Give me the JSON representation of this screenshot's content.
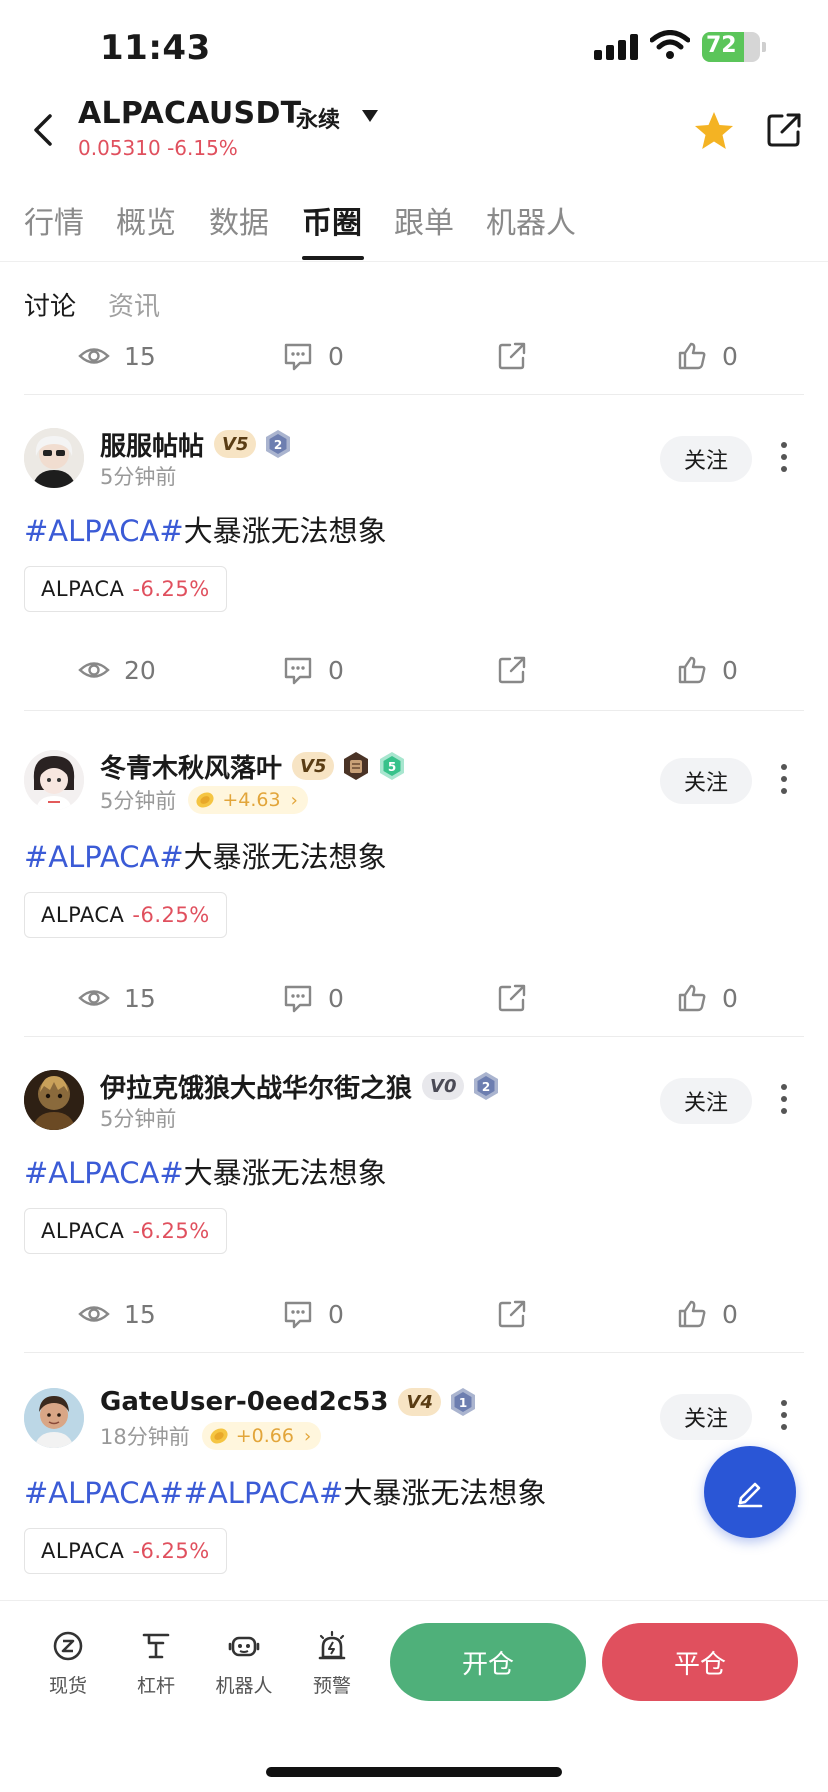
{
  "status_bar": {
    "time": "11:43",
    "battery": "72"
  },
  "header": {
    "pair": "ALPACAUSDT",
    "contract_type": "永续",
    "price_line": "0.05310 -6.15%",
    "colors": {
      "down": "#e0505e",
      "star": "#f4b323"
    }
  },
  "main_tabs": [
    {
      "label": "行情"
    },
    {
      "label": "概览"
    },
    {
      "label": "数据"
    },
    {
      "label": "币圈",
      "active": true
    },
    {
      "label": "跟单"
    },
    {
      "label": "机器人"
    }
  ],
  "sub_tabs": [
    {
      "label": "讨论",
      "active": true
    },
    {
      "label": "资讯"
    }
  ],
  "top_stats": {
    "views": "15",
    "comments": "0",
    "likes": "0"
  },
  "posts": [
    {
      "username": "服服帖帖",
      "vip": "V5",
      "level": "2",
      "time": "5分钟前",
      "earn": "",
      "follow": "关注",
      "tag1": "#ALPACA#",
      "tag2": "",
      "text": "大暴涨无法想象",
      "coin": "ALPACA",
      "change": "-6.25%",
      "views": "20",
      "comments": "0",
      "likes": "0"
    },
    {
      "username": "冬青木秋风落叶",
      "vip": "V5",
      "level": "5",
      "time": "5分钟前",
      "earn": "+4.63",
      "follow": "关注",
      "tag1": "#ALPACA#",
      "tag2": "",
      "text": "大暴涨无法想象",
      "coin": "ALPACA",
      "change": "-6.25%",
      "views": "15",
      "comments": "0",
      "likes": "0"
    },
    {
      "username": "伊拉克饿狼大战华尔街之狼",
      "vip": "V0",
      "level": "2",
      "time": "5分钟前",
      "earn": "",
      "follow": "关注",
      "tag1": "#ALPACA#",
      "tag2": "",
      "text": "大暴涨无法想象",
      "coin": "ALPACA",
      "change": "-6.25%",
      "views": "15",
      "comments": "0",
      "likes": "0"
    },
    {
      "username": "GateUser-0eed2c53",
      "vip": "V4",
      "level": "1",
      "time": "18分钟前",
      "earn": "+0.66",
      "follow": "关注",
      "tag1": "#ALPACA#",
      "tag2": "#ALPACA#",
      "text": "大暴涨无法想象",
      "coin": "ALPACA",
      "change": "-6.25%"
    }
  ],
  "bottom_nav": [
    {
      "label": "现货",
      "icon": "spot-icon"
    },
    {
      "label": "杠杆",
      "icon": "leverage-icon"
    },
    {
      "label": "机器人",
      "icon": "robot-icon"
    },
    {
      "label": "预警",
      "icon": "alert-icon"
    }
  ],
  "actions": {
    "open": "开仓",
    "close": "平仓"
  }
}
